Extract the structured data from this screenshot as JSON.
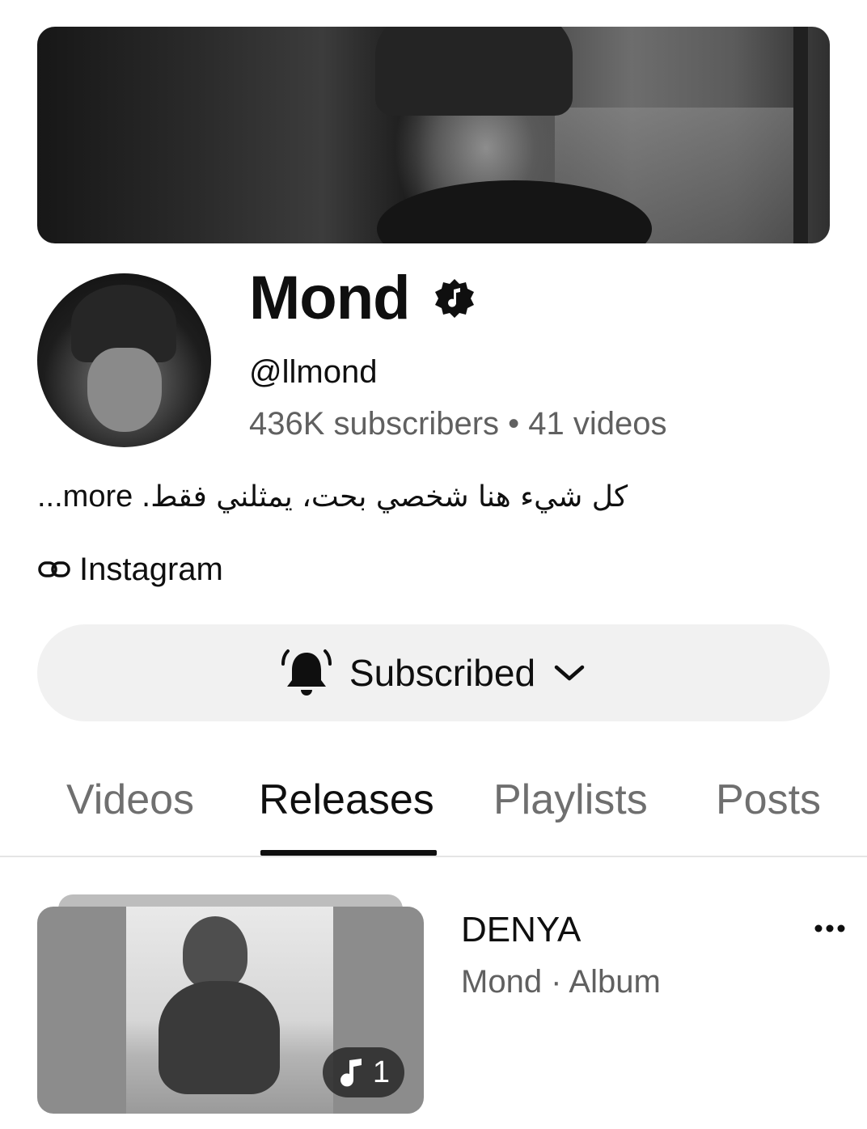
{
  "channel": {
    "name": "Mond",
    "handle": "@llmond",
    "stats": "436K subscribers • 41 videos",
    "description_arabic": "كل شيء هنا شخصي بحت، يمثلني فقط.",
    "description_more": "...more",
    "link_label": "Instagram",
    "verified_icon": "music-note-badge-icon"
  },
  "subscribe": {
    "label": "Subscribed",
    "bell_icon": "bell-ringing-icon",
    "chevron_icon": "chevron-down-icon"
  },
  "tabs": [
    {
      "label": "Videos",
      "active": false
    },
    {
      "label": "Releases",
      "active": true
    },
    {
      "label": "Playlists",
      "active": false
    },
    {
      "label": "Posts",
      "active": false
    }
  ],
  "releases": [
    {
      "title": "DENYA",
      "meta": "Mond · Album",
      "track_count": "1",
      "menu_icon": "more-horizontal-icon"
    }
  ],
  "colors": {
    "text_primary": "#0f0f0f",
    "text_secondary": "#606060",
    "button_bg": "#f1f1f1",
    "tab_inactive": "#6f6f6f"
  }
}
